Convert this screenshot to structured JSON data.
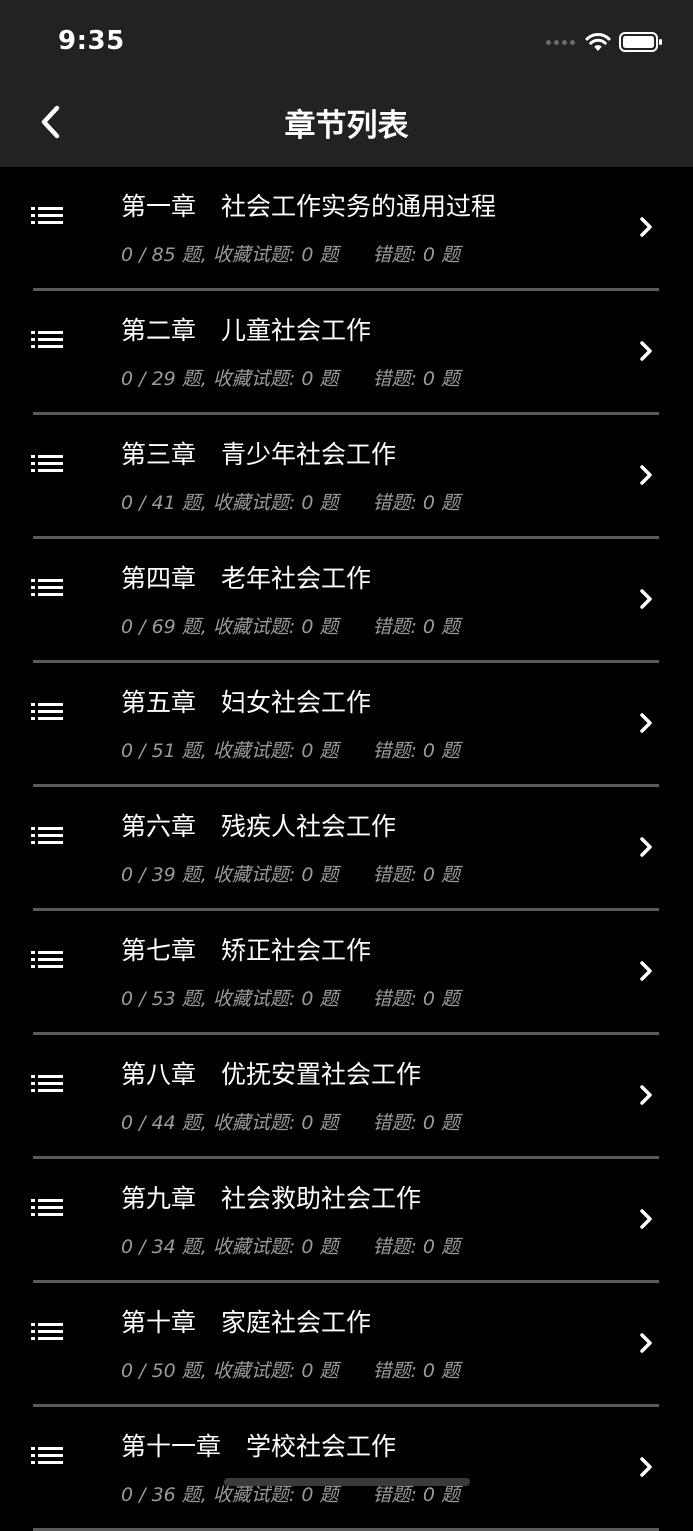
{
  "status_bar": {
    "time": "9:35"
  },
  "nav": {
    "title": "章节列表",
    "back_icon": "chevron-left-icon"
  },
  "chapters": [
    {
      "title": "第一章　社会工作实务的通用过程",
      "count": "0 / 85 题,",
      "favorites": "收藏试题: 0 题",
      "wrong": "错题: 0 题"
    },
    {
      "title": "第二章　儿童社会工作",
      "count": "0 / 29 题,",
      "favorites": "收藏试题: 0 题",
      "wrong": "错题: 0 题"
    },
    {
      "title": "第三章　青少年社会工作",
      "count": "0 / 41 题,",
      "favorites": "收藏试题: 0 题",
      "wrong": "错题: 0 题"
    },
    {
      "title": "第四章　老年社会工作",
      "count": "0 / 69 题,",
      "favorites": "收藏试题: 0 题",
      "wrong": "错题: 0 题"
    },
    {
      "title": "第五章　妇女社会工作",
      "count": "0 / 51 题,",
      "favorites": "收藏试题: 0 题",
      "wrong": "错题: 0 题"
    },
    {
      "title": "第六章　残疾人社会工作",
      "count": "0 / 39 题,",
      "favorites": "收藏试题: 0 题",
      "wrong": "错题: 0 题"
    },
    {
      "title": "第七章　矫正社会工作",
      "count": "0 / 53 题,",
      "favorites": "收藏试题: 0 题",
      "wrong": "错题: 0 题"
    },
    {
      "title": "第八章　优抚安置社会工作",
      "count": "0 / 44 题,",
      "favorites": "收藏试题: 0 题",
      "wrong": "错题: 0 题"
    },
    {
      "title": "第九章　社会救助社会工作",
      "count": "0 / 34 题,",
      "favorites": "收藏试题: 0 题",
      "wrong": "错题: 0 题"
    },
    {
      "title": "第十章　家庭社会工作",
      "count": "0 / 50 题,",
      "favorites": "收藏试题: 0 题",
      "wrong": "错题: 0 题"
    },
    {
      "title": "第十一章　学校社会工作",
      "count": "0 / 36 题,",
      "favorites": "收藏试题: 0 题",
      "wrong": "错题: 0 题"
    }
  ],
  "icons": {
    "row_icon": "list-icon",
    "row_arrow": "chevron-right-icon"
  },
  "colors": {
    "background": "#000000",
    "header": "#222222",
    "meta_text": "#9a9a9a",
    "divider": "#5a5a5a"
  }
}
